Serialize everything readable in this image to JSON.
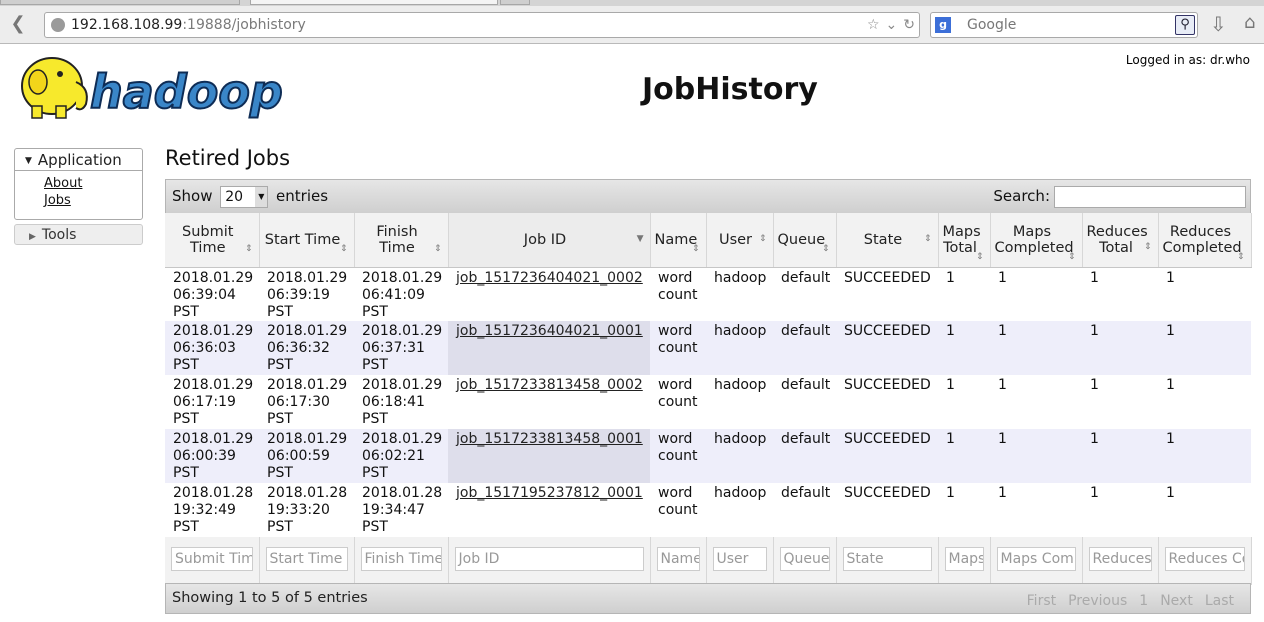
{
  "browser": {
    "url_host": "192.168.108.99",
    "url_rest": ":19888/jobhistory",
    "search_placeholder": "Google"
  },
  "header": {
    "logo_text": "hadoop",
    "title": "JobHistory",
    "login": "Logged in as: dr.who"
  },
  "sidebar": {
    "application_label": "Application",
    "links": [
      "About",
      "Jobs"
    ],
    "tools_label": "Tools"
  },
  "main": {
    "section_title": "Retired Jobs",
    "show_label": "Show",
    "length_value": "20",
    "entries_label": "entries",
    "search_label": "Search:",
    "columns": [
      "Submit Time",
      "Start Time",
      "Finish Time",
      "Job ID",
      "Name",
      "User",
      "Queue",
      "State",
      "Maps Total",
      "Maps Completed",
      "Reduces Total",
      "Reduces Completed"
    ],
    "rows": [
      {
        "submit": [
          "2018.01.29",
          "06:39:04",
          "PST"
        ],
        "start": [
          "2018.01.29",
          "06:39:19",
          "PST"
        ],
        "finish": [
          "2018.01.29",
          "06:41:09",
          "PST"
        ],
        "job_id": "job_1517236404021_0002",
        "name": [
          "word",
          "count"
        ],
        "user": "hadoop",
        "queue": "default",
        "state": "SUCCEEDED",
        "maps_total": "1",
        "maps_completed": "1",
        "reduces_total": "1",
        "reduces_completed": "1"
      },
      {
        "submit": [
          "2018.01.29",
          "06:36:03",
          "PST"
        ],
        "start": [
          "2018.01.29",
          "06:36:32",
          "PST"
        ],
        "finish": [
          "2018.01.29",
          "06:37:31",
          "PST"
        ],
        "job_id": "job_1517236404021_0001",
        "name": [
          "word",
          "count"
        ],
        "user": "hadoop",
        "queue": "default",
        "state": "SUCCEEDED",
        "maps_total": "1",
        "maps_completed": "1",
        "reduces_total": "1",
        "reduces_completed": "1"
      },
      {
        "submit": [
          "2018.01.29",
          "06:17:19",
          "PST"
        ],
        "start": [
          "2018.01.29",
          "06:17:30",
          "PST"
        ],
        "finish": [
          "2018.01.29",
          "06:18:41",
          "PST"
        ],
        "job_id": "job_1517233813458_0002",
        "name": [
          "word",
          "count"
        ],
        "user": "hadoop",
        "queue": "default",
        "state": "SUCCEEDED",
        "maps_total": "1",
        "maps_completed": "1",
        "reduces_total": "1",
        "reduces_completed": "1"
      },
      {
        "submit": [
          "2018.01.29",
          "06:00:39",
          "PST"
        ],
        "start": [
          "2018.01.29",
          "06:00:59",
          "PST"
        ],
        "finish": [
          "2018.01.29",
          "06:02:21",
          "PST"
        ],
        "job_id": "job_1517233813458_0001",
        "name": [
          "word",
          "count"
        ],
        "user": "hadoop",
        "queue": "default",
        "state": "SUCCEEDED",
        "maps_total": "1",
        "maps_completed": "1",
        "reduces_total": "1",
        "reduces_completed": "1"
      },
      {
        "submit": [
          "2018.01.28",
          "19:32:49",
          "PST"
        ],
        "start": [
          "2018.01.28",
          "19:33:20",
          "PST"
        ],
        "finish": [
          "2018.01.28",
          "19:34:47",
          "PST"
        ],
        "job_id": "job_1517195237812_0001",
        "name": [
          "word",
          "count"
        ],
        "user": "hadoop",
        "queue": "default",
        "state": "SUCCEEDED",
        "maps_total": "1",
        "maps_completed": "1",
        "reduces_total": "1",
        "reduces_completed": "1"
      }
    ],
    "filters": [
      "Submit Time",
      "Start Time",
      "Finish Time",
      "Job ID",
      "Name",
      "User",
      "Queue",
      "State",
      "Maps",
      "Maps Comp",
      "Reduces",
      "Reduces Co"
    ],
    "info": "Showing 1 to 5 of 5 entries",
    "pager": {
      "first": "First",
      "previous": "Previous",
      "page": "1",
      "next": "Next",
      "last": "Last"
    }
  }
}
